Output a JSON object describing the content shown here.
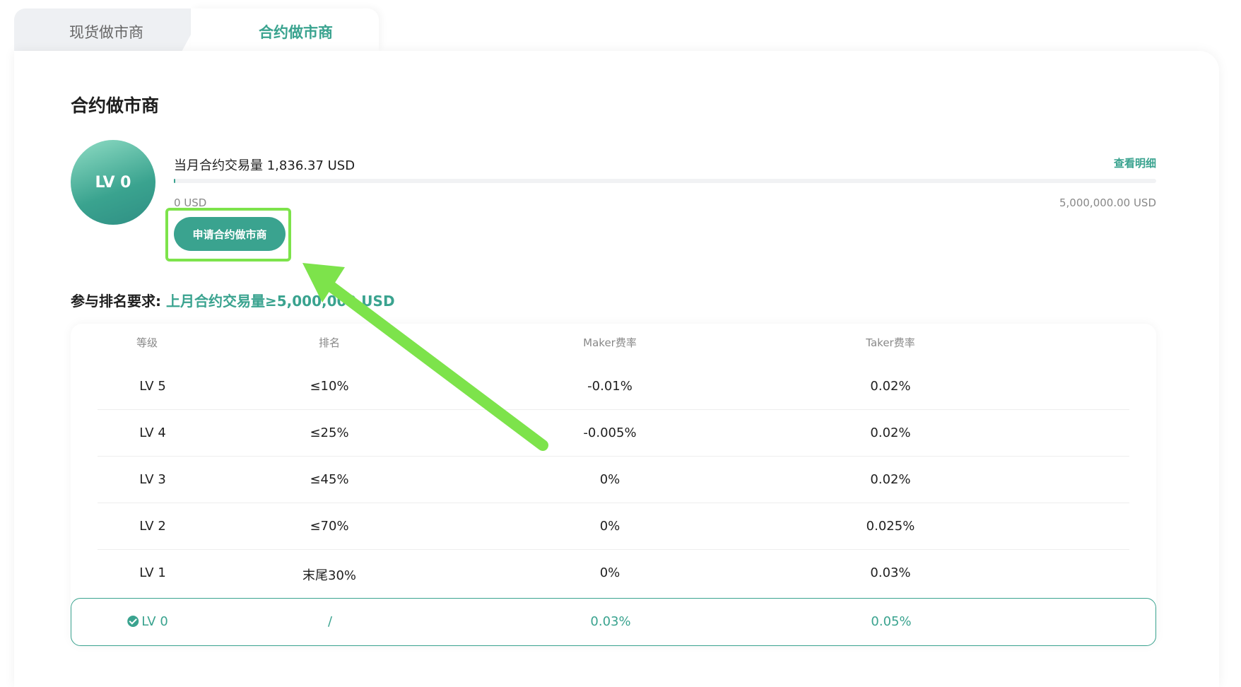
{
  "tabs": [
    {
      "label": "现货做市商",
      "active": false
    },
    {
      "label": "合约做市商",
      "active": true
    }
  ],
  "section": {
    "title": "合约做市商"
  },
  "level": {
    "current": "LV 0"
  },
  "volume": {
    "label": "当月合约交易量",
    "value": "1,836.37 USD",
    "progress_fraction": 0.000367,
    "min_label": "0 USD",
    "max_label": "5,000,000.00 USD",
    "detail_link": "查看明细"
  },
  "apply_button": {
    "label": "申请合约做市商"
  },
  "requirement": {
    "label": "参与排名要求:",
    "value": "上月合约交易量≥5,000,000 USD"
  },
  "table": {
    "headers": [
      "等级",
      "排名",
      "Maker费率",
      "Taker费率"
    ],
    "rows": [
      {
        "level": "LV 5",
        "rank": "≤10%",
        "maker": "-0.01%",
        "taker": "0.02%"
      },
      {
        "level": "LV 4",
        "rank": "≤25%",
        "maker": "-0.005%",
        "taker": "0.02%"
      },
      {
        "level": "LV 3",
        "rank": "≤45%",
        "maker": "0%",
        "taker": "0.02%"
      },
      {
        "level": "LV 2",
        "rank": "≤70%",
        "maker": "0%",
        "taker": "0.025%"
      },
      {
        "level": "LV 1",
        "rank": "末尾30%",
        "maker": "0%",
        "taker": "0.03%"
      }
    ],
    "current_row": {
      "level": "LV 0",
      "rank": "/",
      "maker": "0.03%",
      "taker": "0.05%"
    }
  },
  "colors": {
    "accent": "#3aa38f",
    "annotation": "#7de34b"
  }
}
